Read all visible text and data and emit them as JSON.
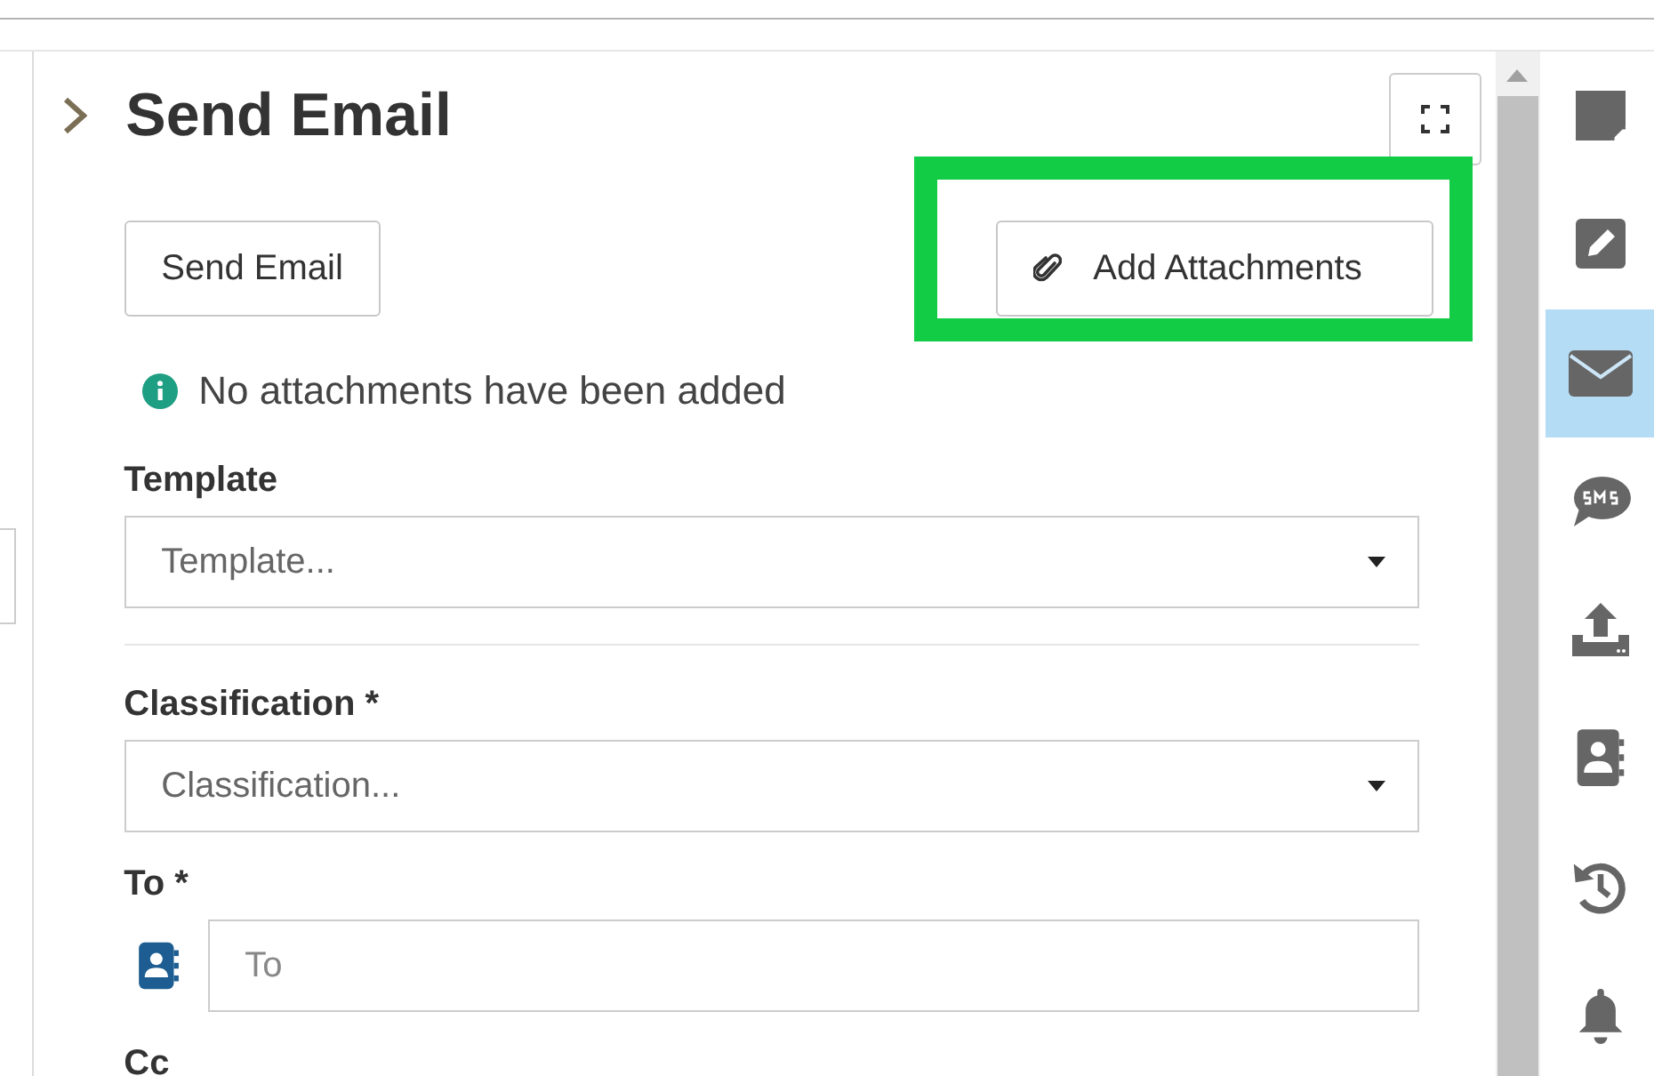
{
  "panel": {
    "title": "Send Email",
    "expanded": false
  },
  "buttons": [
    {
      "label": "Send Email",
      "kind": "plain"
    },
    {
      "label": "Add Attachments",
      "kind": "attach"
    }
  ],
  "info": "No attachments have been added",
  "fields": [
    {
      "label": "Template",
      "kind": "select",
      "placeholder": "Template..."
    },
    {
      "kind": "divider"
    },
    {
      "label": "Classification *",
      "kind": "select",
      "placeholder": "Classification..."
    },
    {
      "label": "To *",
      "kind": "contact",
      "placeholder": "To"
    },
    {
      "label": "Cc",
      "kind": "contact"
    }
  ],
  "sidebar": {
    "items": [
      {
        "kind": "note",
        "selected": false
      },
      {
        "kind": "edit",
        "selected": false
      },
      {
        "kind": "email",
        "selected": true
      },
      {
        "kind": "sms",
        "selected": false
      },
      {
        "kind": "upload",
        "selected": false
      },
      {
        "kind": "contacts",
        "selected": false
      },
      {
        "kind": "history",
        "selected": false
      },
      {
        "kind": "bell",
        "selected": false
      }
    ]
  }
}
